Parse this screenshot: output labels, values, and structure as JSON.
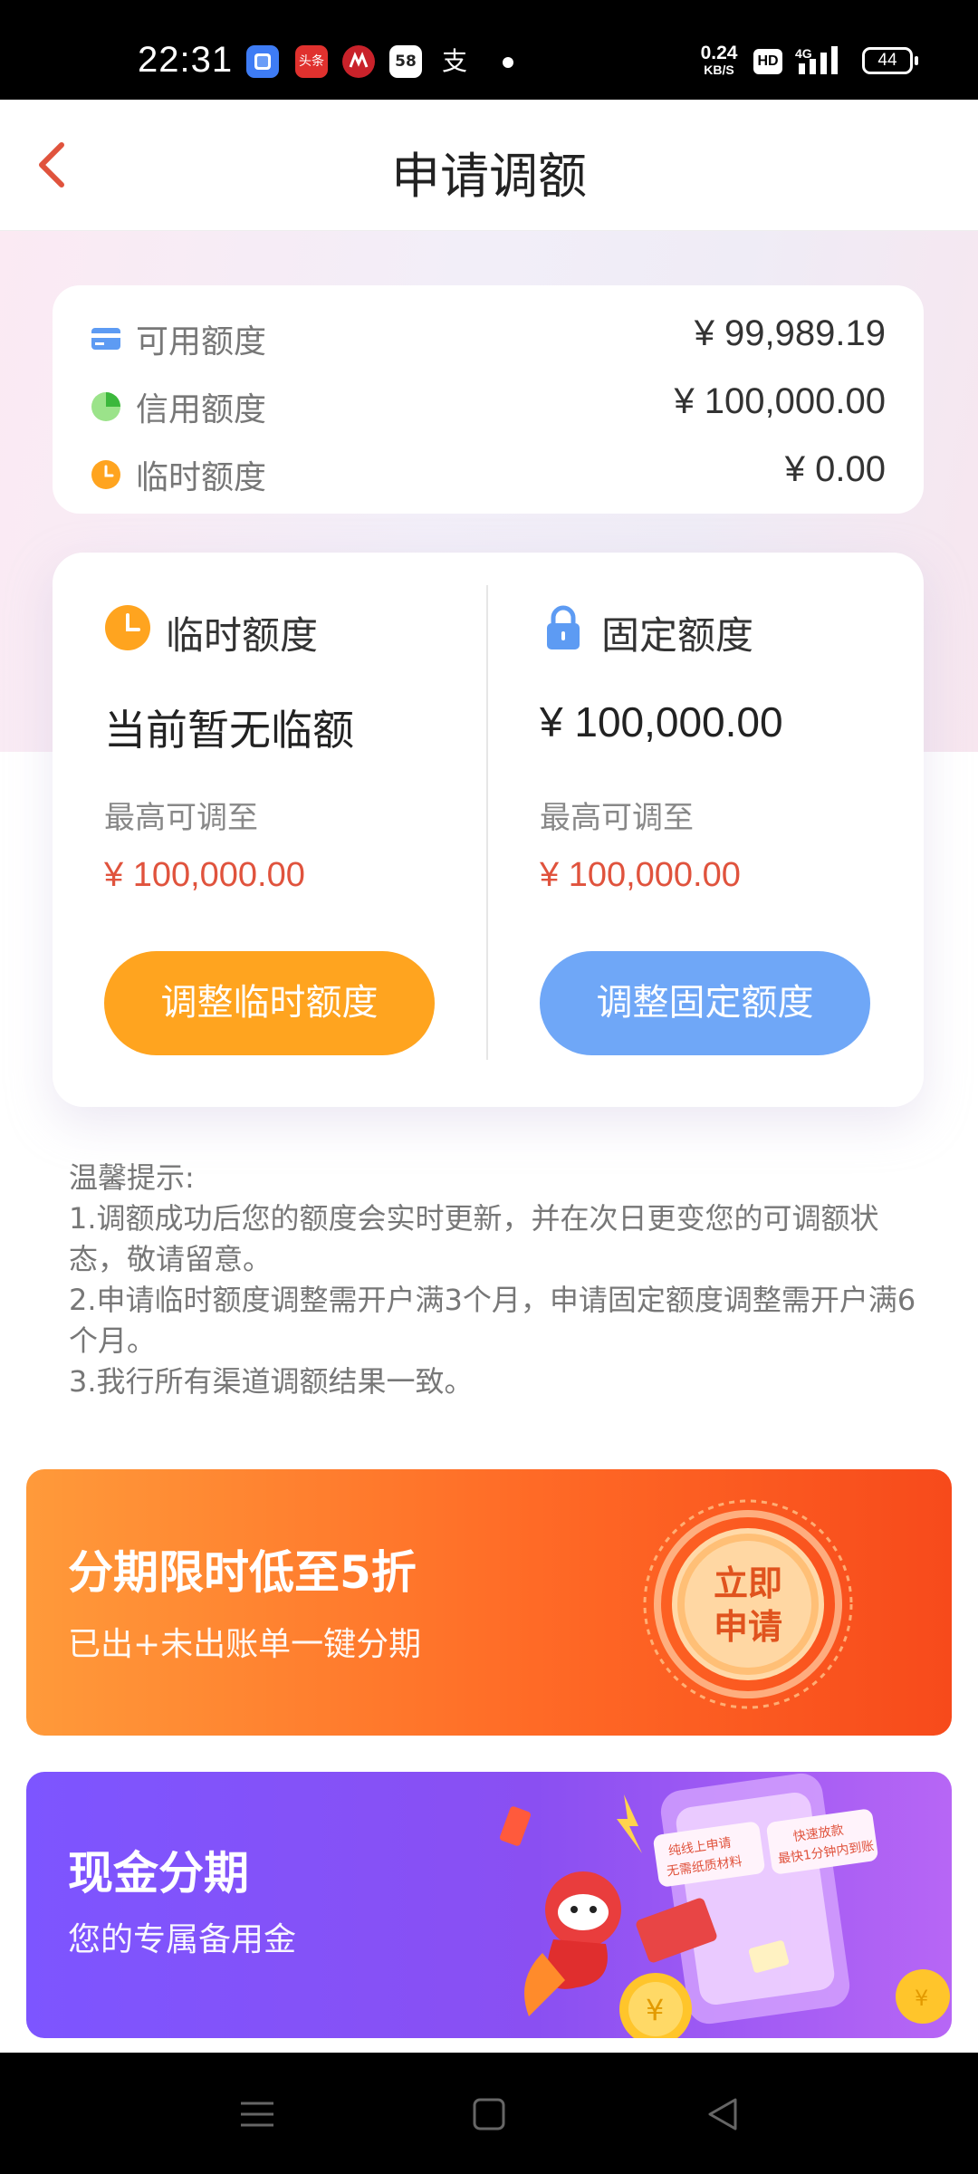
{
  "status_bar": {
    "time": "22:31",
    "apps": [
      {
        "name": "app-icon-blue",
        "glyph": "",
        "color": "#3e7cf5"
      },
      {
        "name": "toutiao-icon",
        "glyph": "头条",
        "color": "#e0312e"
      },
      {
        "name": "cmb-icon",
        "glyph": "",
        "color": "#c9222a"
      },
      {
        "name": "58-icon",
        "glyph": "58",
        "color": "#ffffff"
      },
      {
        "name": "alipay-icon",
        "glyph": "支",
        "color": "#000000"
      }
    ],
    "net_speed": "0.24",
    "net_unit": "KB/S",
    "hd": "HD",
    "network": "4G",
    "battery": "44"
  },
  "nav": {
    "title": "申请调额",
    "back_color": "#e0533d"
  },
  "summary": {
    "rows": [
      {
        "label": "可用额度",
        "value": "¥ 99,989.19",
        "icon": "card-icon"
      },
      {
        "label": "信用额度",
        "value": "¥ 100,000.00",
        "icon": "pie-icon"
      },
      {
        "label": "临时额度",
        "value": "¥ 0.00",
        "icon": "clock-icon"
      }
    ]
  },
  "quota": {
    "temp": {
      "title": "临时额度",
      "current": "当前暂无临额",
      "sub_label": "最高可调至",
      "max": "¥ 100,000.00",
      "button": "调整临时额度"
    },
    "fixed": {
      "title": "固定额度",
      "current": "¥ 100,000.00",
      "sub_label": "最高可调至",
      "max": "¥ 100,000.00",
      "button": "调整固定额度"
    }
  },
  "tips": {
    "title": "温馨提示:",
    "lines": [
      "1.调额成功后您的额度会实时更新，并在次日更变您的可调额状态，敬请留意。",
      "2.申请临时额度调整需开户满3个月，申请固定额度调整需开户满6个月。",
      "3.我行所有渠道调额结果一致。"
    ]
  },
  "banners": {
    "installment": {
      "title": "分期限时低至5折",
      "subtitle": "已出+未出账单一键分期",
      "seal_line1": "立即",
      "seal_line2": "申请"
    },
    "cash": {
      "title": "现金分期",
      "subtitle": "您的专属备用金",
      "tag1_line1": "纯线上申请",
      "tag1_line2": "无需纸质材料",
      "tag2_line1": "快速放款",
      "tag2_line2": "最快1分钟内到账"
    }
  },
  "colors": {
    "accent_red": "#e0533d",
    "orange": "#ffa41f",
    "blue": "#6fa7f7"
  }
}
